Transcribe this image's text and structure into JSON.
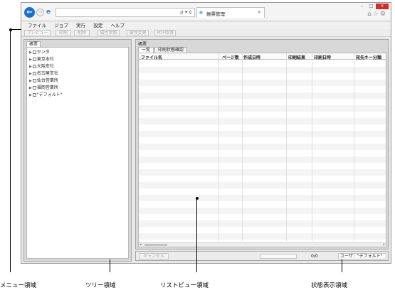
{
  "browser": {
    "tab_title": "帳票管理",
    "address_tools": "ρ ▾ ¢",
    "tab_close": "×",
    "window_controls": [
      "–",
      "□",
      "×"
    ],
    "chrome_icons": "⌂☆⚙"
  },
  "menu": [
    "ファイル",
    "ジョブ",
    "実行",
    "設定",
    "ヘルプ"
  ],
  "toolbar": [
    "プレビュー",
    "印刷",
    "削除",
    "属性参照",
    "属性変更",
    "PDF取得"
  ],
  "tree": {
    "tab": "帳票",
    "items": [
      "センタ",
      "東京本社",
      "大阪支社",
      "名古屋支社",
      "仙台営業所",
      "福岡営業所",
      "\"デフォルト\""
    ]
  },
  "list": {
    "title": "帳票",
    "tabs": [
      "一覧",
      "印刷状態確認"
    ],
    "columns": [
      "ファイル名",
      "ページ数",
      "作成日時",
      "印刷結果",
      "印刷日時",
      "宛先キー分類"
    ]
  },
  "statusbar": {
    "cancel": "キャンセル",
    "count": "0/0",
    "user": "ユーザ：\"デフォルト\""
  },
  "callouts": {
    "menu_area": "メニュー領域",
    "tree_area": "ツリー領域",
    "list_area": "リストビュー領域",
    "status_area": "状態表示領域"
  }
}
